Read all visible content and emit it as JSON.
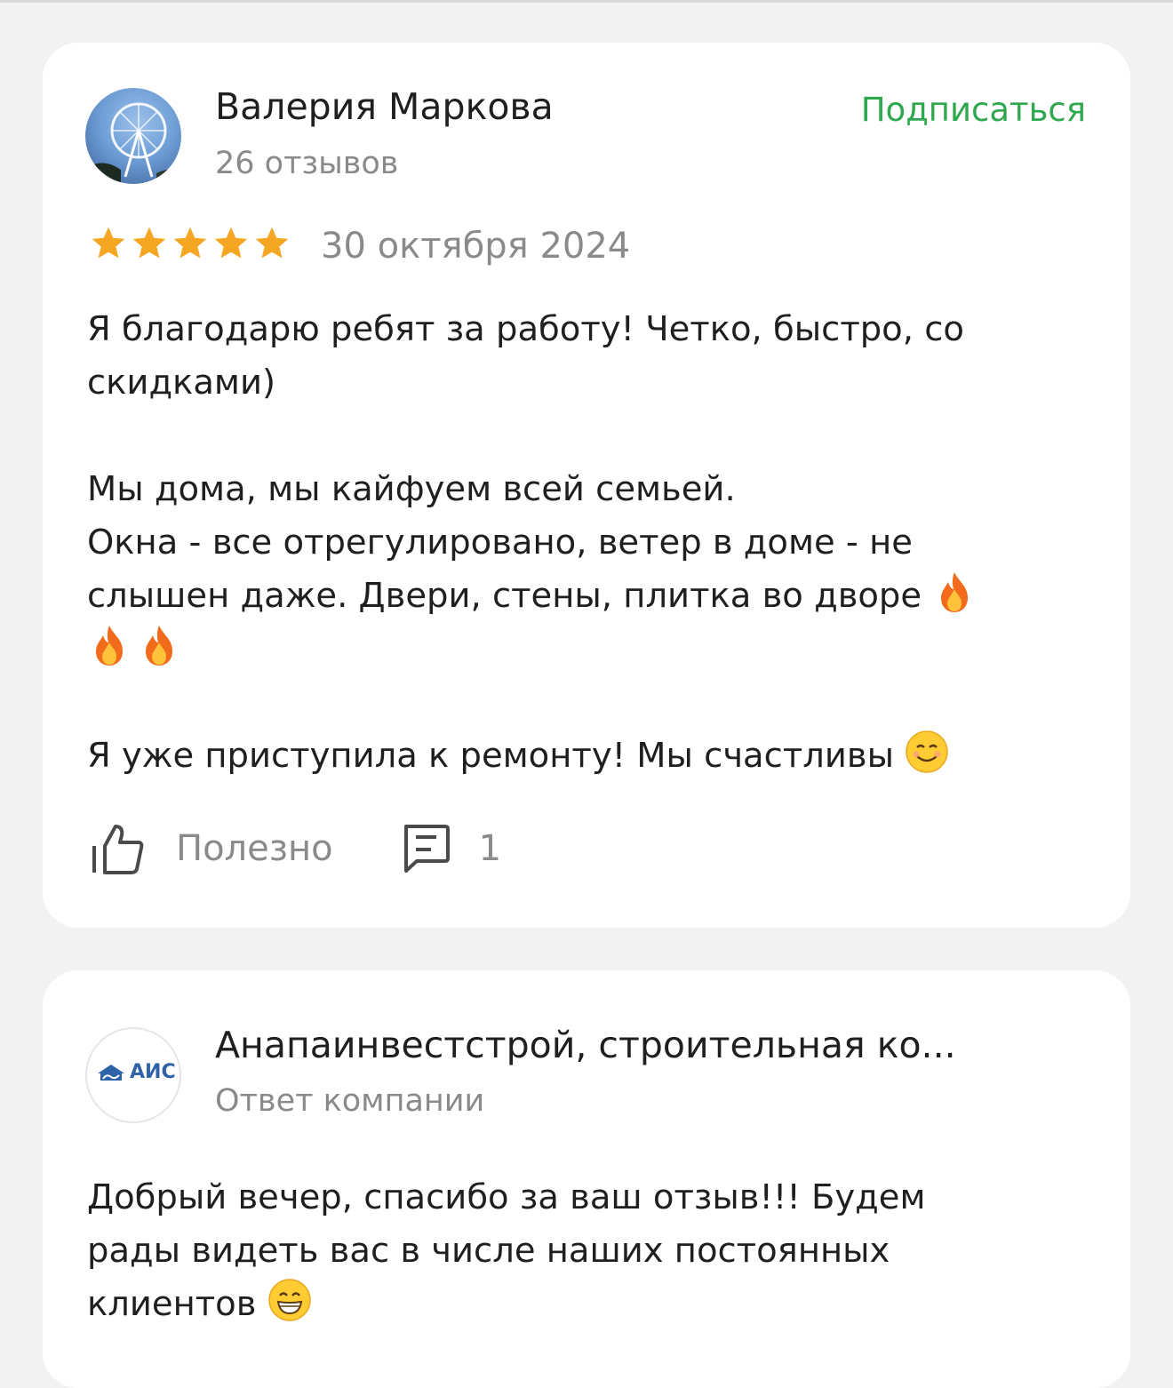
{
  "review": {
    "author": {
      "name": "Валерия Маркова",
      "reviews_count": "26 отзывов",
      "avatar_icon": "ferris-wheel-photo"
    },
    "subscribe_label": "Подписаться",
    "rating": 5,
    "rating_max": 5,
    "date": "30 октября 2024",
    "text": {
      "p1_l1": "Я благодарю ребят за работу! Четко, быстро, со",
      "p1_l2": "скидками)",
      "p2_l1": "Мы дома, мы кайфуем всей семьей.",
      "p2_l2": "Окна - все отрегулировано, ветер в доме - не",
      "p2_l3": "слышен даже. Двери, стены, плитка во дворе",
      "p3_l1": "Я уже приступила к ремонту! Мы счастливы"
    },
    "emojis": [
      "fire-emoji",
      "fire-emoji",
      "fire-emoji",
      "smiling-face-emoji"
    ],
    "actions": {
      "useful_label": "Полезно",
      "comments_count": "1"
    }
  },
  "reply": {
    "company_name": "Анапаинвестстрой, строительная ко...",
    "subtitle": "Ответ компании",
    "logo_text": "АИС",
    "text": {
      "l1": "Добрый вечер, спасибо за ваш отзыв!!! Будем",
      "l2": "рады видеть вас в числе наших постоянных",
      "l3": "клиентов"
    }
  },
  "colors": {
    "accent_green": "#2fa84f",
    "star": "#f5a623",
    "muted_text": "#8a8a8a",
    "page_bg": "#f2f2f2"
  }
}
